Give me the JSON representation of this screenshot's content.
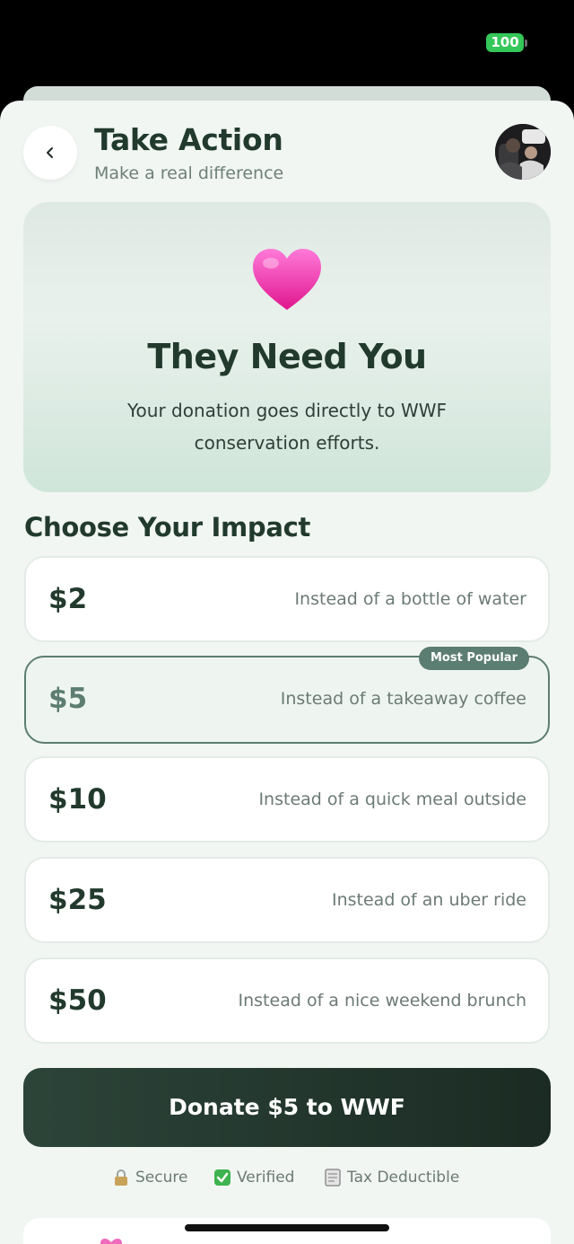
{
  "status_bar": {
    "battery": "100"
  },
  "header": {
    "title": "Take Action",
    "subtitle": "Make a real difference"
  },
  "hero": {
    "icon": "heart-icon",
    "title": "They Need You",
    "description": "Your donation goes directly to WWF conservation efforts."
  },
  "section_title": "Choose Your Impact",
  "options": [
    {
      "amount": "$2",
      "description": "Instead of a bottle of water",
      "selected": false
    },
    {
      "amount": "$5",
      "description": "Instead of a takeaway coffee",
      "selected": true,
      "badge": "Most Popular"
    },
    {
      "amount": "$10",
      "description": "Instead of a quick meal outside",
      "selected": false
    },
    {
      "amount": "$25",
      "description": "Instead of an uber ride",
      "selected": false
    },
    {
      "amount": "$50",
      "description": "Instead of a nice weekend brunch",
      "selected": false
    }
  ],
  "donate_button": "Donate $5 to WWF",
  "trust": {
    "secure": "Secure",
    "verified": "Verified",
    "tax": "Tax Deductible"
  },
  "colors": {
    "primary_dark": "#213a2d",
    "accent": "#5c7d71",
    "background": "#f1f6f3",
    "battery": "#34c759"
  }
}
